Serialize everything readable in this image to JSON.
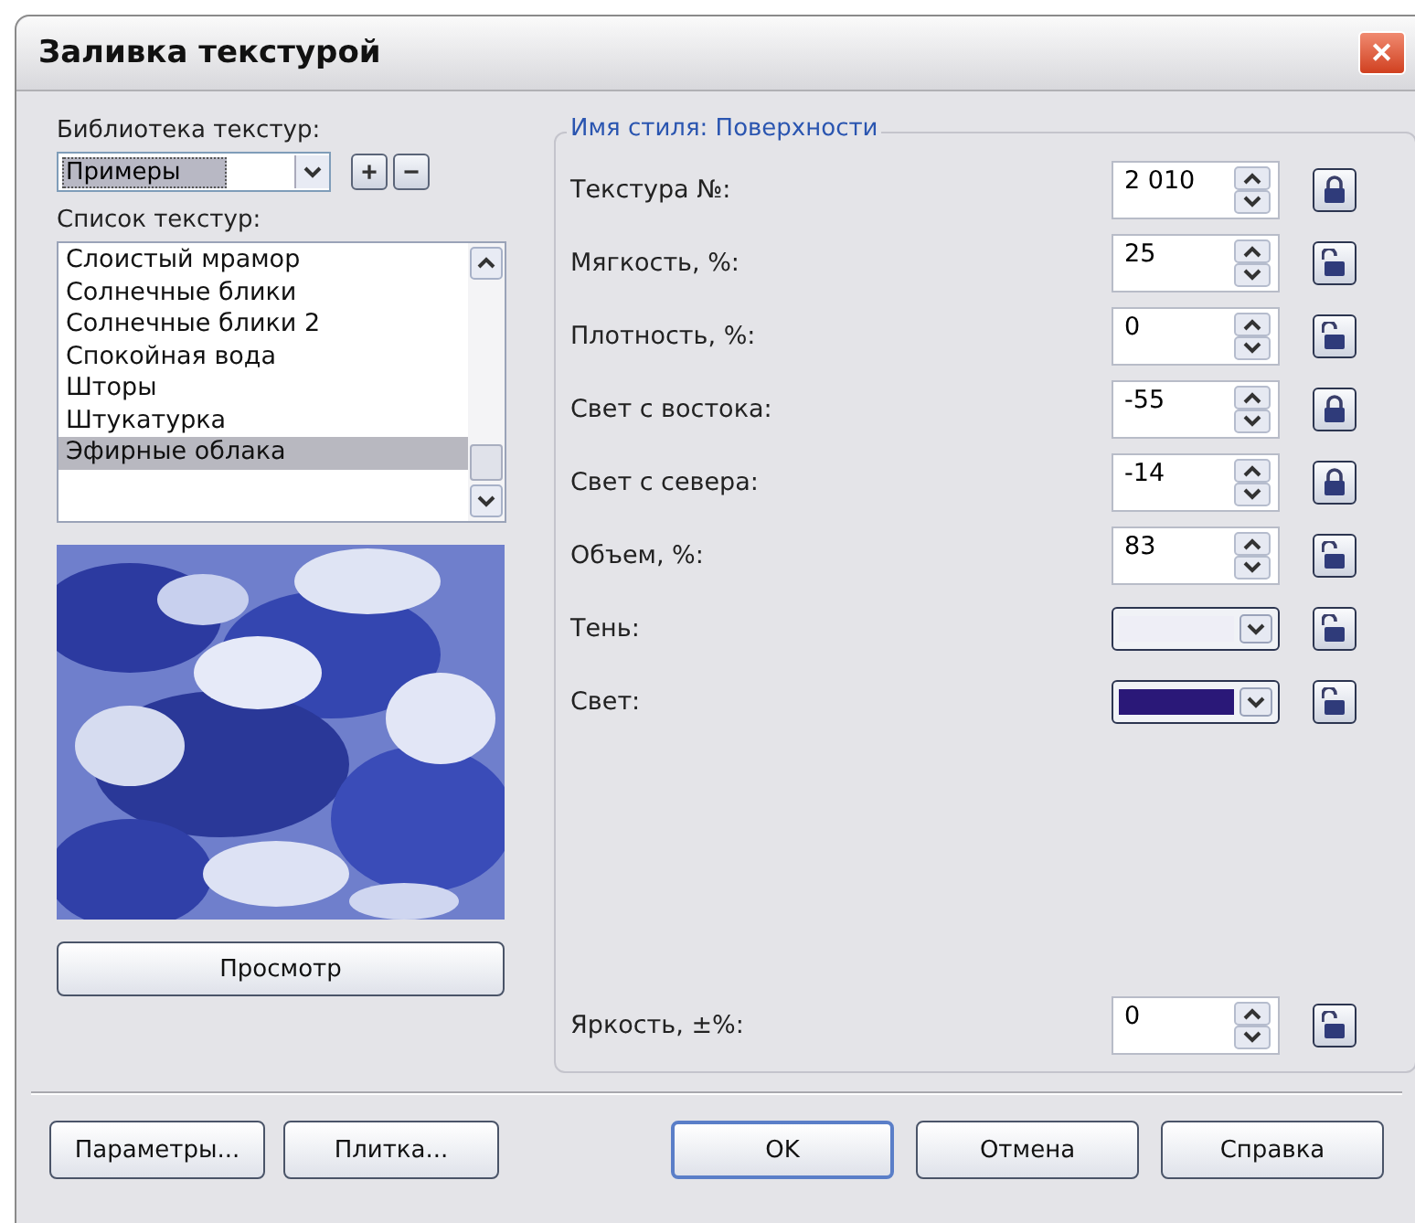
{
  "window": {
    "title": "Заливка текстурой",
    "close": "✕"
  },
  "library": {
    "label": "Библиотека текстур:",
    "value": "Примеры",
    "add": "+",
    "remove": "−"
  },
  "texture_list": {
    "label": "Список текстур:",
    "items": [
      {
        "label": "Слоистый мрамор",
        "selected": false
      },
      {
        "label": "Солнечные блики",
        "selected": false
      },
      {
        "label": "Солнечные блики 2",
        "selected": false
      },
      {
        "label": "Спокойная вода",
        "selected": false
      },
      {
        "label": "Шторы",
        "selected": false
      },
      {
        "label": "Штукатурка",
        "selected": false
      },
      {
        "label": "Эфирные облака",
        "selected": true
      }
    ]
  },
  "preview_button": "Просмотр",
  "style_group": {
    "title": "Имя стиля: Поверхности",
    "rows": [
      {
        "kind": "spin",
        "label": "Текстура №:",
        "value": "2 010",
        "locked": true
      },
      {
        "kind": "spin",
        "label": "Мягкость, %:",
        "value": "25",
        "locked": false
      },
      {
        "kind": "spin",
        "label": "Плотность, %:",
        "value": "0",
        "locked": false
      },
      {
        "kind": "spin",
        "label": "Свет с востока:",
        "value": "-55",
        "locked": true
      },
      {
        "kind": "spin",
        "label": "Свет с севера:",
        "value": "-14",
        "locked": true
      },
      {
        "kind": "spin",
        "label": "Объем, %:",
        "value": "83",
        "locked": false
      },
      {
        "kind": "color",
        "label": "Тень:",
        "color": "#eeeef6",
        "locked": false
      },
      {
        "kind": "color",
        "label": "Свет:",
        "color": "#2a1878",
        "locked": false
      }
    ],
    "bottom_row": {
      "label": "Яркость, ±%:",
      "value": "0",
      "locked": false
    }
  },
  "buttons": {
    "left": [
      "Параметры...",
      "Плитка..."
    ],
    "right": [
      "OK",
      "Отмена",
      "Справка"
    ]
  }
}
